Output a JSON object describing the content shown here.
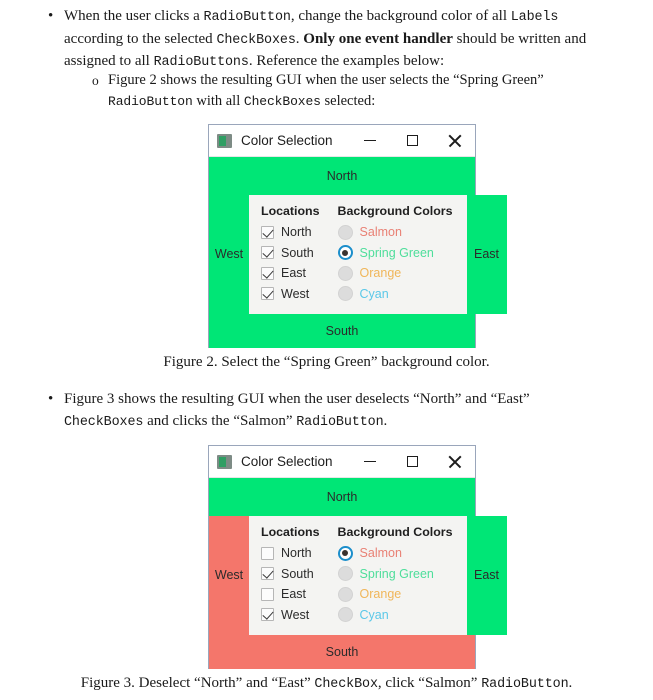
{
  "document": {
    "bullet1": {
      "marker": "•",
      "line_a_pre": "When the user clicks a ",
      "line_a_code": "RadioButton",
      "line_a_post": ", change the background color of all ",
      "line_a_code2": "Labels",
      "line_b_pre": "according to the selected ",
      "line_b_code": "CheckBoxes",
      "line_b_mid": ". ",
      "line_b_bold": "Only one event handler",
      "line_b_post": " should be written and",
      "line_c_pre": "assigned to all ",
      "line_c_code": "RadioButtons",
      "line_c_post": ". Reference the examples below:"
    },
    "subbullet1": {
      "marker": "o",
      "line_a": "Figure 2 shows the resulting GUI when the user selects the “Spring Green”",
      "line_b_code": "RadioButton",
      "line_b_mid": " with all ",
      "line_b_code2": "CheckBoxes",
      "line_b_post": " selected:"
    },
    "caption2": {
      "text": "Figure 2. Select the “Spring Green” background color."
    },
    "bullet2": {
      "marker": "•",
      "line_a": "Figure 3 shows the resulting GUI when the user deselects “North” and “East”",
      "line_b_code": "CheckBoxes",
      "line_b_mid": " and clicks the “Salmon” ",
      "line_b_code2": "RadioButton",
      "line_b_post": "."
    },
    "caption3": {
      "pre": "Figure 3. Deselect “North” and “East” ",
      "code1": "CheckBox",
      "mid": ", click “Salmon” ",
      "code2": "RadioButton",
      "post": "."
    }
  },
  "colors": {
    "spring_green": "#00E676",
    "salmon": "#F4766B",
    "panel_bg": "#F4F4F2",
    "window_border": "#9AA6BB",
    "radio_accent": "#1B8ECB",
    "salmon_text": "#E98175",
    "spring_green_text": "#4EDE9B",
    "orange_text": "#F0B65A",
    "cyan_text": "#5BC8E8",
    "disabled_text": "#BFBFBF"
  },
  "figure2": {
    "window": {
      "title": "Color Selection",
      "icon": "app-window-icon",
      "minimize_label": "minimize",
      "maximize_label": "maximize",
      "close_label": "close"
    },
    "labels": {
      "north": "North",
      "south": "South",
      "west": "West",
      "east": "East"
    },
    "label_colors": {
      "north": "#00E676",
      "south": "#00E676",
      "west": "#00E676",
      "east": "#00E676"
    },
    "panel": {
      "locations_header": "Locations",
      "colors_header": "Background Colors",
      "checkboxes": [
        {
          "label": "North",
          "checked": true
        },
        {
          "label": "South",
          "checked": true
        },
        {
          "label": "East",
          "checked": true
        },
        {
          "label": "West",
          "checked": true
        }
      ],
      "radios": [
        {
          "label": "Salmon",
          "selected": false,
          "color": "#E98175"
        },
        {
          "label": "Spring Green",
          "selected": true,
          "color": "#4EDE9B"
        },
        {
          "label": "Orange",
          "selected": false,
          "color": "#F0B65A"
        },
        {
          "label": "Cyan",
          "selected": false,
          "color": "#5BC8E8"
        }
      ]
    }
  },
  "figure3": {
    "window": {
      "title": "Color Selection",
      "icon": "app-window-icon",
      "minimize_label": "minimize",
      "maximize_label": "maximize",
      "close_label": "close"
    },
    "labels": {
      "north": "North",
      "south": "South",
      "west": "West",
      "east": "East"
    },
    "label_colors": {
      "north": "#00E676",
      "south": "#F4766B",
      "west": "#F4766B",
      "east": "#00E676"
    },
    "panel": {
      "locations_header": "Locations",
      "colors_header": "Background Colors",
      "checkboxes": [
        {
          "label": "North",
          "checked": false
        },
        {
          "label": "South",
          "checked": true
        },
        {
          "label": "East",
          "checked": false
        },
        {
          "label": "West",
          "checked": true
        }
      ],
      "radios": [
        {
          "label": "Salmon",
          "selected": true,
          "color": "#E98175"
        },
        {
          "label": "Spring Green",
          "selected": false,
          "color": "#4EDE9B"
        },
        {
          "label": "Orange",
          "selected": false,
          "color": "#F0B65A"
        },
        {
          "label": "Cyan",
          "selected": false,
          "color": "#5BC8E8"
        }
      ]
    }
  }
}
